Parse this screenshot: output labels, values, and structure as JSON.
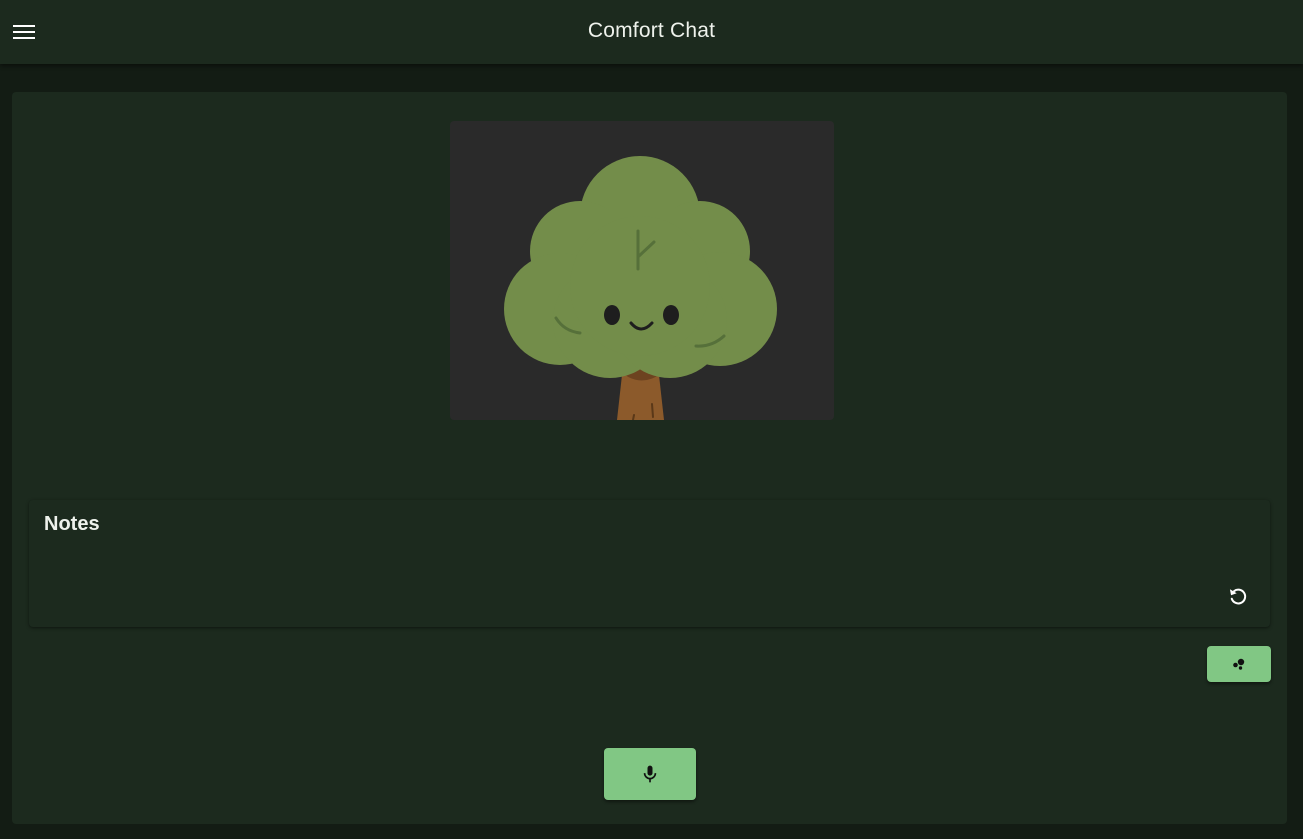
{
  "app": {
    "title": "Comfort Chat",
    "menu_icon": "menu-icon"
  },
  "avatar": {
    "icon": "smiling-tree-avatar",
    "colors": {
      "canopy": "#738d4a",
      "trunk": "#8c5a2b",
      "frame": "#2a2a2a"
    }
  },
  "notes": {
    "title": "Notes",
    "content": "",
    "reset_icon": "refresh-icon"
  },
  "actions": {
    "bubbles_icon": "bubbles-icon",
    "mic_icon": "microphone-icon"
  },
  "colors": {
    "background": "#131c14",
    "surface": "#1c2a1e",
    "accent": "#81c784",
    "text": "#eef2ec"
  }
}
